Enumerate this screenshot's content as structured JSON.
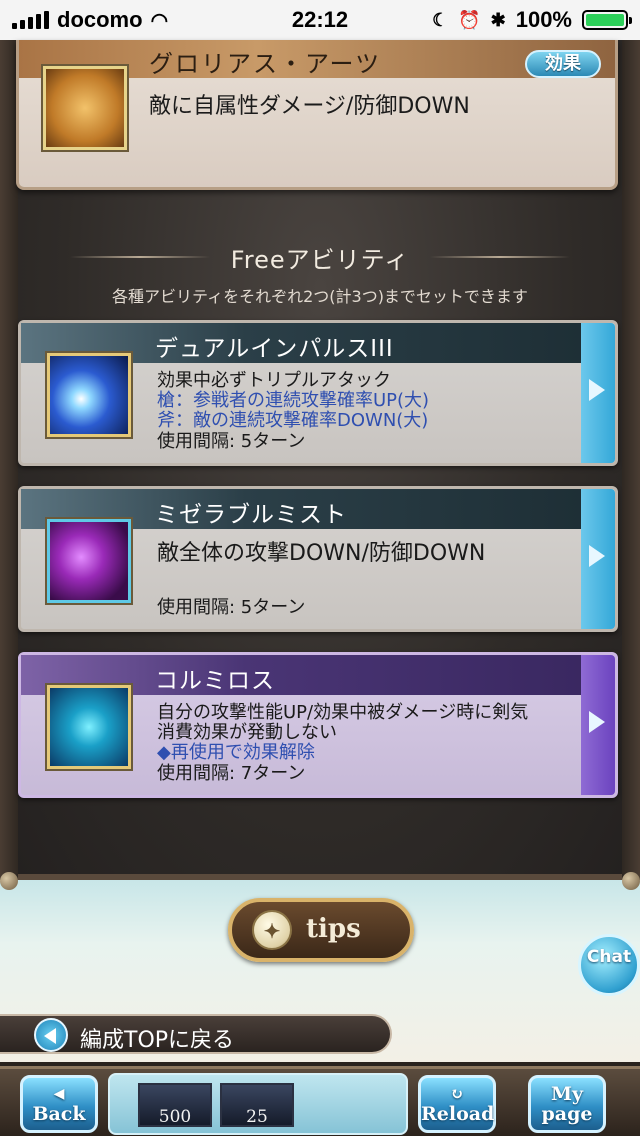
{
  "status_bar": {
    "carrier": "docomo",
    "time": "22:12",
    "battery": "100%"
  },
  "top_card": {
    "title": "グロリアス・アーツ",
    "effect_button": "効果",
    "description": "敵に自属性ダメージ/防御DOWN"
  },
  "free_section": {
    "title": "Freeアビリティ",
    "subtitle": "各種アビリティをそれぞれ2つ(計3つ)までセットできます"
  },
  "abilities": [
    {
      "name": "デュアルインパルスIII",
      "lines": [
        "効果中必ずトリプルアタック"
      ],
      "blue_lines": [
        "槍：参戦者の連続攻撃確率UP(大)",
        "斧：敵の連続攻撃確率DOWN(大)"
      ],
      "interval": "使用間隔: 5ターン"
    },
    {
      "name": "ミゼラブルミスト",
      "lines": [
        "敵全体の攻撃DOWN/防御DOWN"
      ],
      "interval": "使用間隔: 5ターン"
    },
    {
      "name": "コルミロス",
      "lines": [
        "自分の攻撃性能UP/効果中被ダメージ時に剣気",
        "消費効果が発動しない"
      ],
      "blue_lines": [
        "◆再使用で効果解除"
      ],
      "interval": "使用間隔: 7ターン"
    }
  ],
  "tips_button": "tips",
  "chat_button": "Chat",
  "back_to_top": "編成TOPに戻る",
  "bottom_nav": {
    "back": "Back",
    "item1_count": "500",
    "item2_count": "25",
    "reload": "Reload",
    "mypage_line1": "My",
    "mypage_line2": "page"
  }
}
